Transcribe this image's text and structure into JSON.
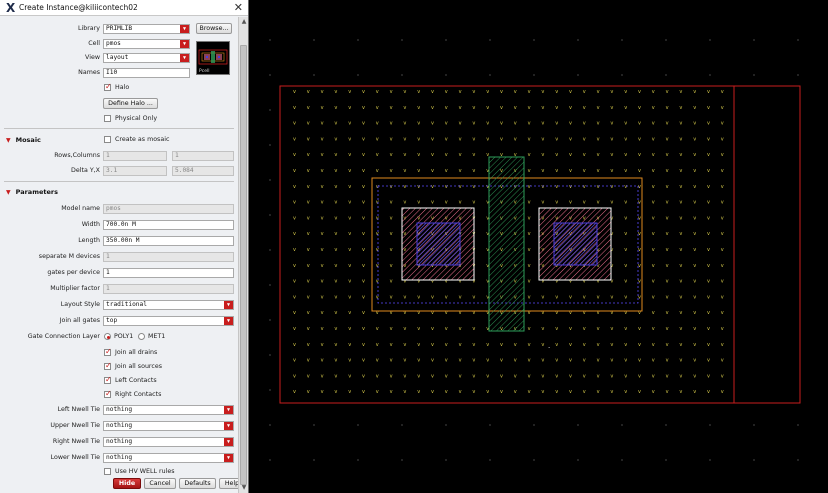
{
  "window": {
    "title": "Create Instance@kiliicontech02",
    "close_glyph": "✕"
  },
  "form": {
    "library": {
      "label": "Library",
      "value": "PRIMLIB",
      "browse": "Browse..."
    },
    "cell": {
      "label": "Cell",
      "value": "pmos"
    },
    "view": {
      "label": "View",
      "value": "layout"
    },
    "names": {
      "label": "Names",
      "value": "I10"
    },
    "halo": {
      "label": "Halo",
      "checked": true
    },
    "define_halo": "Define Halo ...",
    "physical_only": {
      "label": "Physical Only",
      "checked": false
    },
    "preview_caption": "Pcell"
  },
  "mosaic": {
    "title": "Mosaic",
    "create_as_mosaic": "Create as mosaic",
    "rows_columns": {
      "label": "Rows,Columns",
      "rows": "1",
      "cols": "1"
    },
    "delta": {
      "label": "Delta Y,X",
      "y": "3.1",
      "x": "5.084"
    }
  },
  "parameters": {
    "title": "Parameters",
    "model_name": {
      "label": "Model name",
      "value": "pmos"
    },
    "width": {
      "label": "Width",
      "value": "700.0n M"
    },
    "length": {
      "label": "Length",
      "value": "350.00n M"
    },
    "separate_m": {
      "label": "separate M devices",
      "value": "1"
    },
    "gates_per_device": {
      "label": "gates per device",
      "value": "1"
    },
    "multiplier": {
      "label": "Multiplier factor",
      "value": "1"
    },
    "layout_style": {
      "label": "Layout Style",
      "value": "traditional"
    },
    "join_all_gates": {
      "label": "Join all gates",
      "value": "top"
    },
    "gate_connection_layer": {
      "label": "Gate Connection Layer",
      "options": [
        "POLY1",
        "MET1"
      ],
      "selected": "POLY1"
    },
    "checks": [
      {
        "label": "Join all drains",
        "checked": true
      },
      {
        "label": "Join all sources",
        "checked": true
      },
      {
        "label": "Left Contacts",
        "checked": true
      },
      {
        "label": "Right Contacts",
        "checked": true
      }
    ],
    "left_nwell_tie": {
      "label": "Left Nwell Tie",
      "value": "nothing"
    },
    "upper_nwell_tie": {
      "label": "Upper Nwell Tie",
      "value": "nothing"
    },
    "right_nwell_tie": {
      "label": "Right Nwell Tie",
      "value": "nothing"
    },
    "lower_nwell_tie": {
      "label": "Lower Nwell Tie",
      "value": "nothing"
    },
    "use_hv_well": {
      "label": "Use HV WELL rules",
      "checked": false
    }
  },
  "buttons": {
    "hide": "Hide",
    "cancel": "Cancel",
    "defaults": "Defaults",
    "help": "Help"
  },
  "colors": {
    "accent_red": "#c81e1e",
    "nwell_border": "#c81e1e",
    "pdiff_border": "#e08a1e",
    "poly_green": "#2e9e5a",
    "contact_blue": "#4a3cdc",
    "metal_pink": "#e86c8c",
    "grid_dot": "#d4c84a"
  }
}
